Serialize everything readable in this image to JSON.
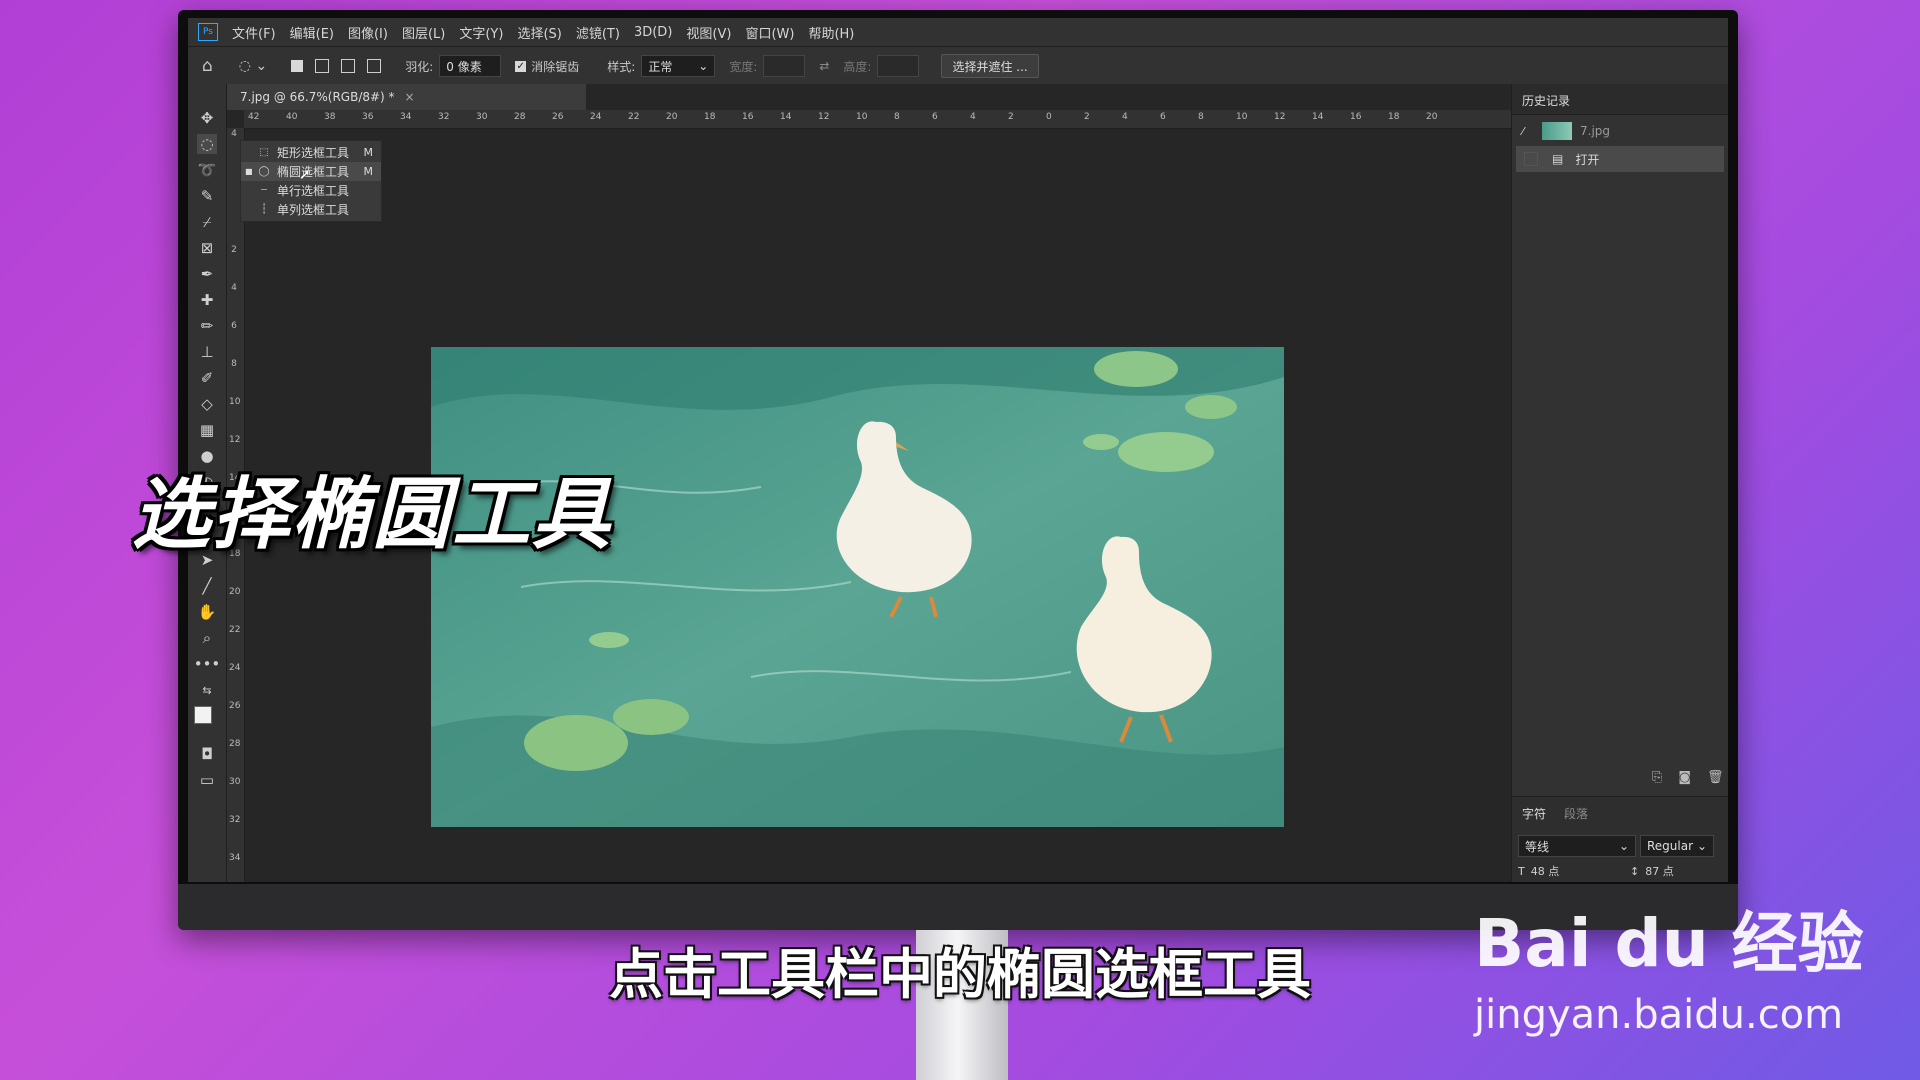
{
  "menubar": {
    "app_logo": "Ps",
    "items": [
      "文件(F)",
      "编辑(E)",
      "图像(I)",
      "图层(L)",
      "文字(Y)",
      "选择(S)",
      "滤镜(T)",
      "3D(D)",
      "视图(V)",
      "窗口(W)",
      "帮助(H)"
    ]
  },
  "options_bar": {
    "feather_label": "羽化:",
    "feather_value": "0 像素",
    "antialias_label": "消除锯齿",
    "style_label": "样式:",
    "style_value": "正常",
    "width_label": "宽度:",
    "height_label": "高度:",
    "select_mask_button": "选择并遮住 ..."
  },
  "document": {
    "tab_title": "7.jpg @ 66.7%(RGB/8#) *",
    "tab_close": "×"
  },
  "rulers": {
    "horizontal": [
      "42",
      "40",
      "38",
      "36",
      "34",
      "32",
      "30",
      "28",
      "26",
      "24",
      "22",
      "20",
      "18",
      "16",
      "14",
      "12",
      "10",
      "8",
      "6",
      "4",
      "2",
      "0",
      "2",
      "4",
      "6",
      "8",
      "10",
      "12",
      "14",
      "16",
      "18",
      "20"
    ],
    "vertical": [
      "4",
      "2",
      "4",
      "6",
      "8",
      "10",
      "12",
      "14",
      "16",
      "18",
      "20",
      "22",
      "24",
      "26",
      "28",
      "30",
      "32",
      "34"
    ]
  },
  "tool_flyout": {
    "items": [
      {
        "label": "矩形选框工具",
        "key": "M",
        "icon": "rect-marquee-icon",
        "active": false
      },
      {
        "label": "椭圆选框工具",
        "key": "M",
        "icon": "ellipse-marquee-icon",
        "active": true
      },
      {
        "label": "单行选框工具",
        "key": "",
        "icon": "row-marquee-icon",
        "active": false
      },
      {
        "label": "单列选框工具",
        "key": "",
        "icon": "column-marquee-icon",
        "active": false
      }
    ]
  },
  "history_panel": {
    "title": "历史记录",
    "snapshot_label": "7.jpg",
    "steps": [
      "打开"
    ]
  },
  "character_panel": {
    "tabs": [
      "字符",
      "段落"
    ],
    "font_family": "等线",
    "font_style": "Regular",
    "font_size": "48 点",
    "leading": "87 点"
  },
  "overlay": {
    "title": "选择椭圆工具",
    "subtitle": "点击工具栏中的椭圆选框工具"
  },
  "watermark": {
    "brand": "Bai du 经验",
    "url": "jingyan.baidu.com"
  },
  "colors": {
    "accent": "#31a8ff",
    "panel_bg": "#323232",
    "canvas_bg": "#262626"
  }
}
